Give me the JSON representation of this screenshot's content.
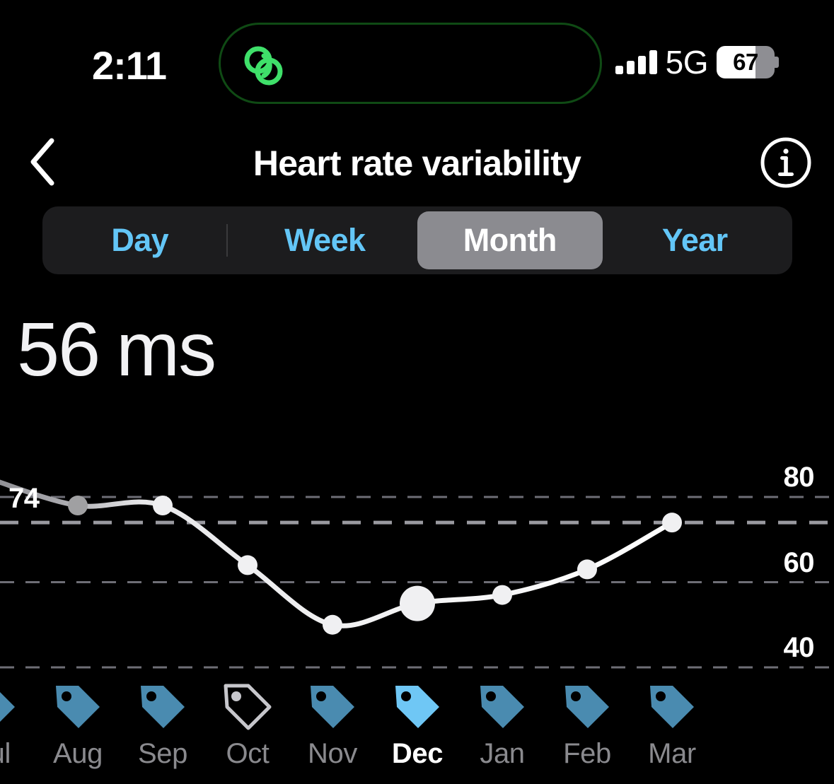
{
  "status_bar": {
    "time": "2:11",
    "network": "5G",
    "battery_percent": "67",
    "battery_level": 67,
    "signal_bars": 4,
    "island_icon": "link-rings-icon",
    "island_accent": "#3FE06A"
  },
  "nav": {
    "back_icon": "chevron-left-icon",
    "title": "Heart rate variability",
    "info_icon": "info-circle-icon"
  },
  "segmented": {
    "options": [
      {
        "label": "Day",
        "selected": false
      },
      {
        "label": "Week",
        "selected": false
      },
      {
        "label": "Month",
        "selected": true
      },
      {
        "label": "Year",
        "selected": false
      }
    ],
    "accent": "#63C6F7",
    "selected_bg": "#8B8B90"
  },
  "summary": {
    "value": "56",
    "unit": "ms"
  },
  "chart_data": {
    "type": "line",
    "title": "Heart rate variability",
    "ylabel": "ms",
    "xlabel": "",
    "ylim": [
      34,
      86
    ],
    "grid": true,
    "gridlines": [
      {
        "value": 80,
        "label": "80",
        "side": "right",
        "style": "dashed"
      },
      {
        "value": 74,
        "label": "74",
        "side": "left",
        "style": "dashed-bold",
        "note": "average"
      },
      {
        "value": 60,
        "label": "60",
        "side": "right",
        "style": "dashed"
      },
      {
        "value": 40,
        "label": "40",
        "side": "right",
        "style": "dashed"
      }
    ],
    "average": 74,
    "categories": [
      "Jul",
      "Aug",
      "Sep",
      "Oct",
      "Nov",
      "Dec",
      "Jan",
      "Feb",
      "Mar"
    ],
    "values": [
      84,
      78,
      78,
      64,
      50,
      55,
      57,
      63,
      74
    ],
    "selected_index": 5,
    "selected_label": "Dec",
    "selected_value": 56,
    "line_color": "#FFFFFF",
    "point_color": "#F0F0F2",
    "faded_point_color": "#A0A0A2"
  },
  "months": [
    {
      "label": "Jul",
      "icon": "tag-icon",
      "state": "partial",
      "color": "#4A8BB0"
    },
    {
      "label": "Aug",
      "icon": "tag-icon",
      "state": "filled",
      "color": "#4A8BB0"
    },
    {
      "label": "Sep",
      "icon": "tag-icon",
      "state": "filled",
      "color": "#4A8BB0"
    },
    {
      "label": "Oct",
      "icon": "tag-icon",
      "state": "outline",
      "color": "#C7C7CC"
    },
    {
      "label": "Nov",
      "icon": "tag-icon",
      "state": "filled",
      "color": "#4A8BB0"
    },
    {
      "label": "Dec",
      "icon": "tag-icon",
      "state": "current",
      "color": "#6FC7F5"
    },
    {
      "label": "Jan",
      "icon": "tag-icon",
      "state": "filled",
      "color": "#4A8BB0"
    },
    {
      "label": "Feb",
      "icon": "tag-icon",
      "state": "filled",
      "color": "#4A8BB0"
    },
    {
      "label": "Mar",
      "icon": "tag-icon",
      "state": "filled",
      "color": "#4A8BB0"
    }
  ]
}
